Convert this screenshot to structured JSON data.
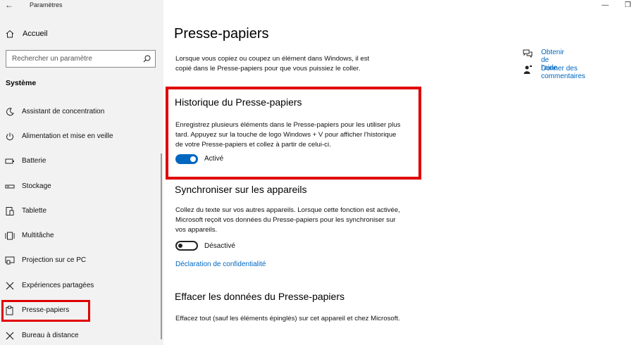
{
  "window": {
    "title": "Paramètres"
  },
  "sidebar": {
    "home_label": "Accueil",
    "search_placeholder": "Rechercher un paramètre",
    "section_title": "Système",
    "items": [
      {
        "label": "Assistant de concentration",
        "icon": "moon-icon"
      },
      {
        "label": "Alimentation et mise en veille",
        "icon": "power-icon"
      },
      {
        "label": "Batterie",
        "icon": "battery-icon"
      },
      {
        "label": "Stockage",
        "icon": "storage-icon"
      },
      {
        "label": "Tablette",
        "icon": "tablet-icon"
      },
      {
        "label": "Multitâche",
        "icon": "multitask-icon"
      },
      {
        "label": "Projection sur ce PC",
        "icon": "projection-icon"
      },
      {
        "label": "Expériences partagées",
        "icon": "shared-icon"
      },
      {
        "label": "Presse-papiers",
        "icon": "clipboard-icon"
      },
      {
        "label": "Bureau à distance",
        "icon": "remote-desktop-icon"
      }
    ]
  },
  "main": {
    "title": "Presse-papiers",
    "intro": "Lorsque vous copiez ou coupez un élément dans Windows, il est copié dans le Presse-papiers pour que vous puissiez le coller.",
    "history": {
      "heading": "Historique du Presse-papiers",
      "description": "Enregistrez plusieurs éléments dans le Presse-papiers pour les utiliser plus tard. Appuyez sur la touche de logo Windows + V pour afficher l'historique de votre Presse-papiers et collez à partir de celui-ci.",
      "toggle_label": "Activé"
    },
    "sync": {
      "heading": "Synchroniser sur les appareils",
      "description": "Collez du texte sur vos autres appareils. Lorsque cette fonction est activée, Microsoft reçoit vos données du Presse-papiers pour les synchroniser sur vos appareils.",
      "toggle_label": "Désactivé",
      "privacy_link": "Déclaration de confidentialité"
    },
    "clear": {
      "heading": "Effacer les données du Presse-papiers",
      "description": "Effacez tout (sauf les éléments épinglés) sur cet appareil et chez Microsoft."
    },
    "help": {
      "get_help": "Obtenir de l'aide",
      "feedback": "Donner des commentaires"
    }
  },
  "colors": {
    "accent": "#0067c0",
    "highlight": "#e00000",
    "sidebar_bg": "#f2f2f2"
  }
}
